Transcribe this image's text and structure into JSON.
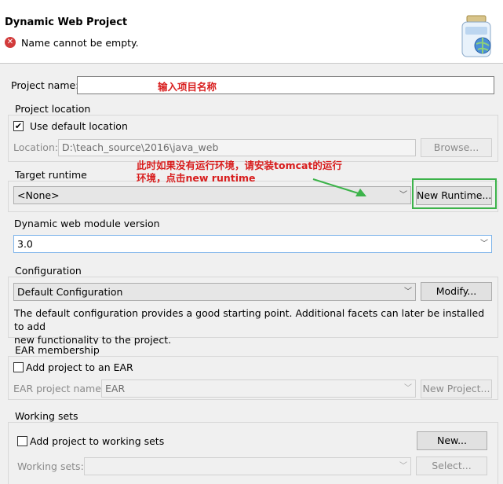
{
  "header": {
    "title": "Dynamic Web Project",
    "error_message": "Name cannot be empty."
  },
  "project_name": {
    "label": "Project name:",
    "value": "",
    "annotation": "输入项目名称"
  },
  "project_location": {
    "group_label": "Project location",
    "use_default_label": "Use default location",
    "use_default_checked": true,
    "location_label": "Location:",
    "location_value": "D:\\teach_source\\2016\\java_web",
    "browse_label": "Browse..."
  },
  "target_runtime": {
    "group_label": "Target runtime",
    "selected": "<None>",
    "new_runtime_label": "New Runtime...",
    "annotation_line1": "此时如果没有运行环境，请安装tomcat的运行",
    "annotation_line2": "环境，点击new runtime"
  },
  "module_version": {
    "label": "Dynamic web module version",
    "selected": "3.0"
  },
  "configuration": {
    "group_label": "Configuration",
    "selected": "Default Configuration",
    "modify_label": "Modify...",
    "description_line1": "The default configuration provides a good starting point. Additional facets can later be installed to add",
    "description_line2": "new functionality to the project."
  },
  "ear_membership": {
    "group_label": "EAR membership",
    "add_label": "Add project to an EAR",
    "add_checked": false,
    "ear_name_label": "EAR project name:",
    "ear_name_value": "EAR",
    "new_project_label": "New Project..."
  },
  "working_sets": {
    "group_label": "Working sets",
    "add_label": "Add project to working sets",
    "add_checked": false,
    "new_label": "New...",
    "sets_label": "Working sets:",
    "sets_value": "",
    "select_label": "Select..."
  },
  "colors": {
    "annotation": "#d81e1e",
    "highlight": "#3cb34a",
    "error": "#d23b3b"
  }
}
